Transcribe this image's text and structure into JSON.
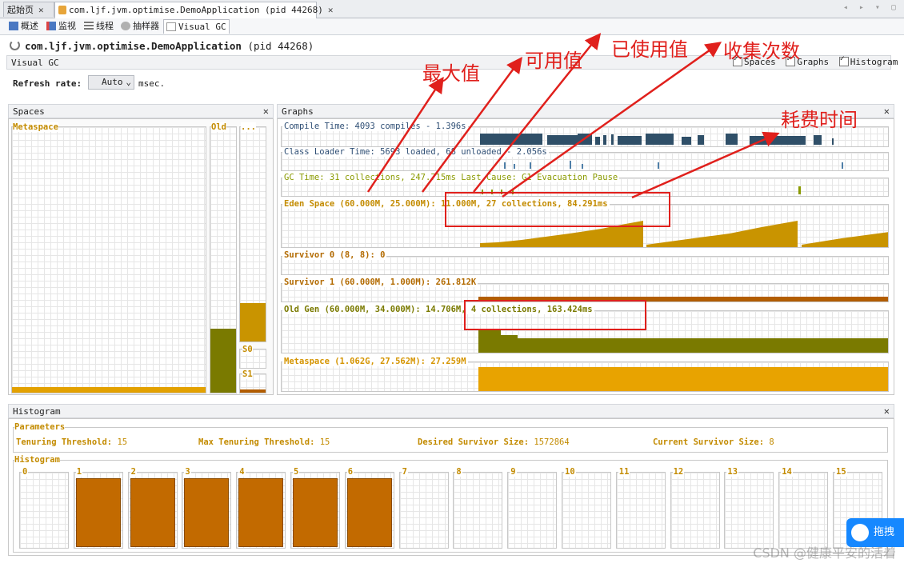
{
  "tabs": [
    {
      "label": "起始页",
      "closable": true
    },
    {
      "label": "com.ljf.jvm.optimise.DemoApplication (pid 44268)",
      "closable": true
    }
  ],
  "subtabs": [
    "概述",
    "监视",
    "线程",
    "抽样器",
    "Visual GC"
  ],
  "app_title": {
    "name": "com.ljf.jvm.optimise.DemoApplication",
    "pid": "(pid 44268)"
  },
  "visual_gc": {
    "label": "Visual GC",
    "options": [
      {
        "label": "Spaces",
        "checked": true
      },
      {
        "label": "Graphs",
        "checked": true
      },
      {
        "label": "Histogram",
        "checked": true
      }
    ],
    "refresh_label": "Refresh rate:",
    "refresh_value": "Auto",
    "refresh_unit": "msec."
  },
  "spaces": {
    "title": "Spaces",
    "metaspace_label": "Metaspace",
    "old_label": "Old",
    "eden_label": "...",
    "s0_label": "S0",
    "s1_label": "S1",
    "fill_levels": {
      "metaspace": 0.03,
      "old": 0.24,
      "eden": 0.24,
      "s0": 0.0,
      "s1": 0.2
    }
  },
  "graphs": {
    "title": "Graphs",
    "rows": [
      {
        "label": "Compile Time: 4093 compiles - 1.396s",
        "color": "#2f4f68"
      },
      {
        "label": "Class Loader Time: 5693 loaded, 68 unloaded - 2.056s",
        "color": "#4f7fa8"
      },
      {
        "label": "GC Time: 31 collections, 247.715ms Last Cause: G1 Evacuation Pause",
        "color": "#8a9a00"
      },
      {
        "label": "Eden Space (60.000M, 25.000M): 11.000M, 27 collections, 84.291ms",
        "color": "#c38b00"
      },
      {
        "label": "Survivor 0 (8, 8): 0",
        "color": "#b26a00"
      },
      {
        "label": "Survivor 1 (60.000M, 1.000M): 261.812K",
        "color": "#b26a00"
      },
      {
        "label": "Old Gen (60.000M, 34.000M): 14.706M, 4 collections, 163.424ms",
        "color": "#7a7a00"
      },
      {
        "label": "Metaspace (1.062G, 27.562M): 27.259M",
        "color": "#e0a000"
      }
    ]
  },
  "annotations": {
    "max": "最大值",
    "available": "可用值",
    "used": "已使用值",
    "count": "收集次数",
    "time": "耗费时间"
  },
  "histogram": {
    "title": "Histogram",
    "params_title": "Parameters",
    "params": [
      {
        "label": "Tenuring Threshold:",
        "value": "15"
      },
      {
        "label": "Max Tenuring Threshold:",
        "value": "15"
      },
      {
        "label": "Desired Survivor Size:",
        "value": "1572864"
      },
      {
        "label": "Current Survivor Size:",
        "value": "8"
      }
    ],
    "hist_title": "Histogram",
    "buckets": [
      "0",
      "1",
      "2",
      "3",
      "4",
      "5",
      "6",
      "7",
      "8",
      "9",
      "10",
      "11",
      "12",
      "13",
      "14",
      "15"
    ],
    "bucket_fill": [
      0,
      1,
      1,
      1,
      1,
      1,
      1,
      0,
      0,
      0,
      0,
      0,
      0,
      0,
      0,
      0
    ]
  },
  "widget_label": "拖拽",
  "watermark": "CSDN @健康平安的活着"
}
